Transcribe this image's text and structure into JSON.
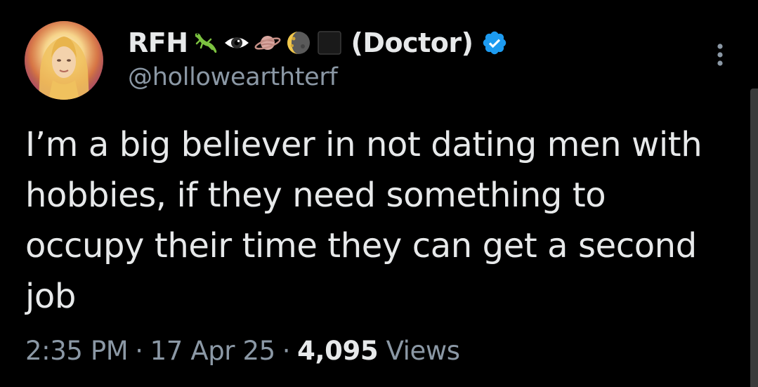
{
  "author": {
    "display_name": "RFH",
    "name_emojis": [
      "lizard-emoji",
      "eye-emoji",
      "ringed-planet-emoji",
      "moon-emoji",
      "black-square-emoji"
    ],
    "name_suffix": "(Doctor)",
    "handle": "@hollowearthterf",
    "verified": true
  },
  "tweet": {
    "text": "I’m a big believer in not dating men with hobbies, if they need something to occupy their time they can get a second job",
    "time": "2:35 PM",
    "date": "17 Apr 25",
    "separator": "·",
    "views_count": "4,095",
    "views_label": "Views"
  },
  "icons": {
    "more": "more-vertical-icon",
    "verified": "verified-badge-icon"
  },
  "colors": {
    "background": "#000000",
    "primary_text": "#e7e9ea",
    "secondary_text": "#8b98a5",
    "verified_blue": "#1d9bf0"
  }
}
